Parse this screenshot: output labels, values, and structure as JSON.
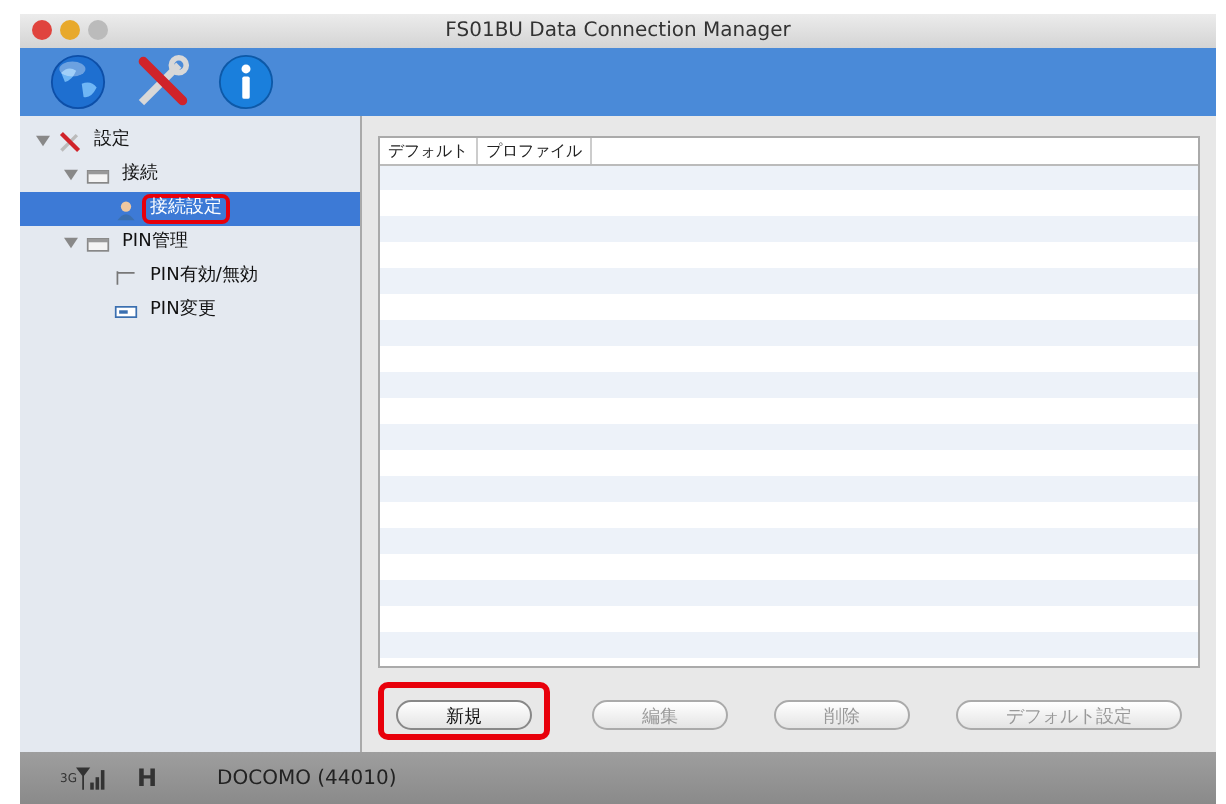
{
  "window": {
    "title": "FS01BU Data Connection Manager"
  },
  "toolbar": {
    "items": [
      {
        "kind": "globe"
      },
      {
        "kind": "tools"
      },
      {
        "kind": "info"
      }
    ]
  },
  "sidebar": {
    "tree": [
      {
        "label": "設定",
        "kind": "tools",
        "expanded": true,
        "selected": false,
        "highlighted": false,
        "children": [
          {
            "label": "接続",
            "kind": "folder",
            "expanded": true,
            "selected": false,
            "highlighted": false,
            "children": [
              {
                "label": "接続設定",
                "kind": "user",
                "selected": true,
                "highlighted": true
              }
            ]
          },
          {
            "label": "PIN管理",
            "kind": "folder",
            "expanded": true,
            "selected": false,
            "highlighted": false,
            "children": [
              {
                "label": "PIN有効/無効",
                "kind": "toggle",
                "selected": false,
                "highlighted": false
              },
              {
                "label": "PIN変更",
                "kind": "field",
                "selected": false,
                "highlighted": false
              }
            ]
          }
        ]
      }
    ]
  },
  "table": {
    "columns": [
      "デフォルト",
      "プロファイル"
    ]
  },
  "buttons": [
    {
      "label": "新規",
      "disabled": false,
      "highlighted": true
    },
    {
      "label": "編集",
      "disabled": true,
      "highlighted": false
    },
    {
      "label": "削除",
      "disabled": true,
      "highlighted": false
    },
    {
      "label": "デフォルト設定",
      "disabled": true,
      "highlighted": false
    }
  ],
  "status_bar": {
    "network": "3G",
    "mode": "H",
    "carrier": "DOCOMO (44010)"
  }
}
